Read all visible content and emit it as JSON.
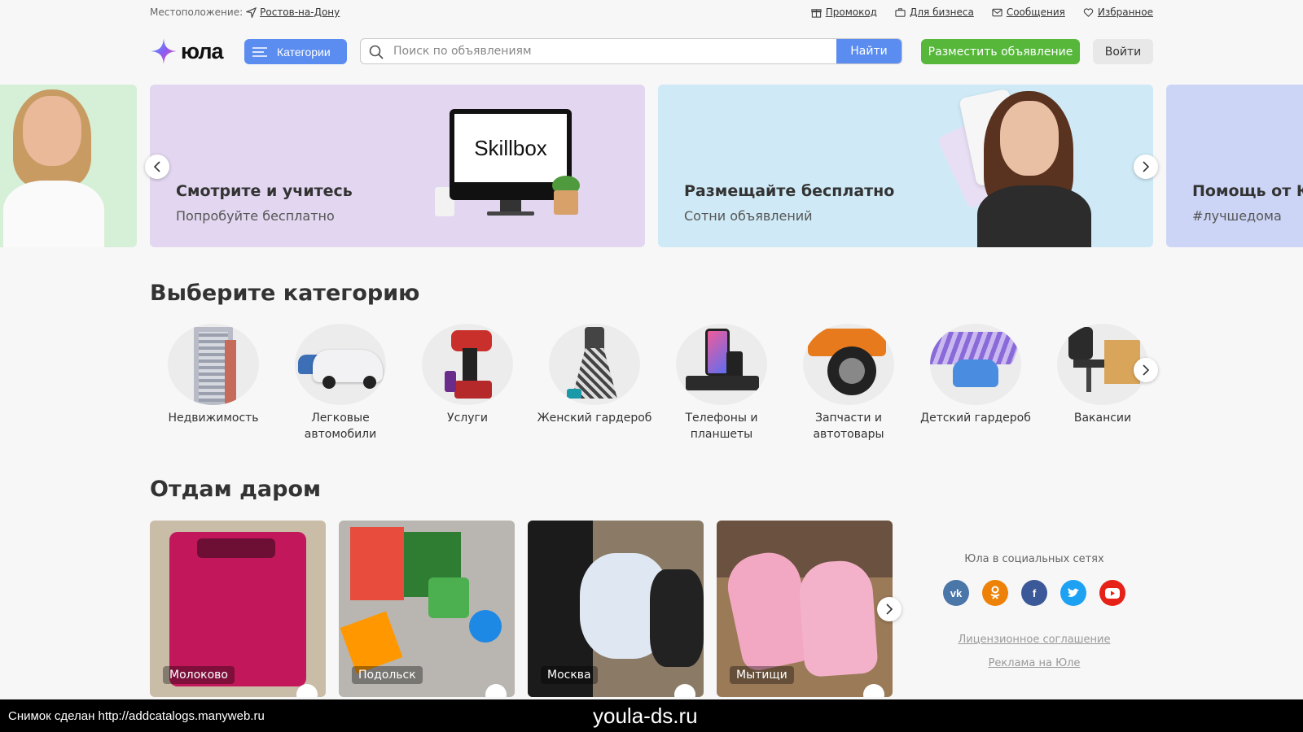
{
  "topbar": {
    "location_label": "Местоположение:",
    "location_value": "Ростов-на-Дону",
    "links": [
      "Промокод",
      "Для бизнеса",
      "Сообщения",
      "Избранное"
    ]
  },
  "header": {
    "logo_text": "юла",
    "categories_button": "Категории",
    "search_placeholder": "Поиск по объявлениям",
    "search_button": "Найти",
    "post_button": "Разместить объявление",
    "login_button": "Войти"
  },
  "banners": [
    {
      "title": "Смотрите и учитесь",
      "subtitle": "Попробуйте бесплатно",
      "screen_text": "Skillbox"
    },
    {
      "title": "Размещайте бесплатно",
      "subtitle": "Сотни объявлений"
    },
    {
      "title": "Помощь от Юл",
      "subtitle": "#лучшедома"
    }
  ],
  "categories_section": {
    "title": "Выберите категорию",
    "items": [
      {
        "label": "Недвижимость"
      },
      {
        "label": "Легковые автомобили"
      },
      {
        "label": "Услуги"
      },
      {
        "label": "Женский гардероб"
      },
      {
        "label": "Телефоны и планшеты"
      },
      {
        "label": "Запчасти и автотовары"
      },
      {
        "label": "Детский гардероб"
      },
      {
        "label": "Вакансии"
      }
    ]
  },
  "free_section": {
    "title": "Отдам даром",
    "items": [
      {
        "city": "Молоково"
      },
      {
        "city": "Подольск"
      },
      {
        "city": "Москва"
      },
      {
        "city": "Мытищи"
      }
    ]
  },
  "social": {
    "title": "Юла в социальных сетях",
    "networks": [
      "vk-icon",
      "ok-icon",
      "facebook-icon",
      "twitter-icon",
      "youtube-icon"
    ],
    "license_link": "Лицензионное соглашение",
    "ads_link": "Реклама на Юле"
  },
  "watermark": {
    "left": "Снимок сделан http://addcatalogs.manyweb.ru",
    "center": "youla-ds.ru"
  },
  "colors": {
    "accent_blue": "#5b8df0",
    "post_green": "#56b73b",
    "vk": "#4a76a8",
    "ok": "#ee8208",
    "facebook": "#3b5998",
    "twitter": "#1da1f2",
    "youtube": "#e62117"
  }
}
